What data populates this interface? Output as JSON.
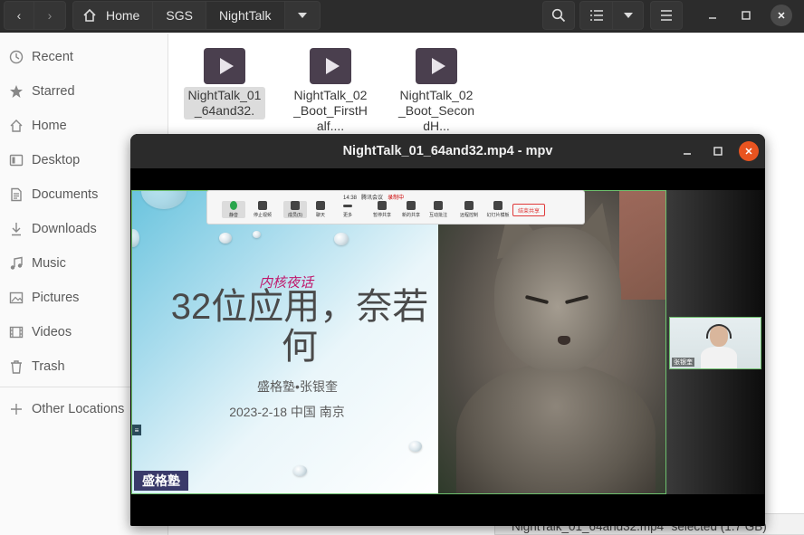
{
  "window": {
    "nav": {
      "back": "back-arrow",
      "forward": "forward-arrow"
    },
    "breadcrumbs": [
      "Home",
      "SGS",
      "NightTalk"
    ],
    "controls": {
      "search": "search-icon",
      "view": "list-view-icon",
      "menu": "hamburger-icon",
      "minimize": "minimize-icon",
      "maximize": "maximize-icon",
      "close": "close-icon"
    }
  },
  "sidebar": {
    "items": [
      {
        "label": "Recent",
        "icon": "clock-icon"
      },
      {
        "label": "Starred",
        "icon": "star-icon"
      },
      {
        "label": "Home",
        "icon": "home-icon"
      },
      {
        "label": "Desktop",
        "icon": "desktop-icon"
      },
      {
        "label": "Documents",
        "icon": "document-icon"
      },
      {
        "label": "Downloads",
        "icon": "download-icon"
      },
      {
        "label": "Music",
        "icon": "music-icon"
      },
      {
        "label": "Pictures",
        "icon": "picture-icon"
      },
      {
        "label": "Videos",
        "icon": "video-icon"
      },
      {
        "label": "Trash",
        "icon": "trash-icon"
      }
    ],
    "other": {
      "label": "Other Locations",
      "icon": "plus-icon"
    }
  },
  "files": [
    {
      "name": "NightTalk_01_64and32.",
      "selected": true
    },
    {
      "name": "NightTalk_02_Boot_FirstHalf....",
      "selected": false
    },
    {
      "name": "NightTalk_02_Boot_SecondH...",
      "selected": false
    }
  ],
  "statusbar": {
    "text": "NightTalk_01_64and32.mp4\" selected (1.7 GB)"
  },
  "mpv": {
    "title": "NightTalk_01_64and32.mp4 - mpv",
    "meeting": {
      "time": "14:38",
      "app": "腾讯会议",
      "rec": "录制中",
      "buttons": [
        "静音",
        "停止视频",
        "成员(5)",
        "聊天",
        "更多",
        "暂停共享",
        "新的共享",
        "互动批注",
        "远程控制",
        "幻灯片模板"
      ],
      "end": "结束共享"
    },
    "slide": {
      "topic": "内核夜话",
      "title": "32位应用，奈若何",
      "author": "盛格塾•张银奎",
      "date": "2023-2-18 中国 南京",
      "logo": "盛格塾"
    },
    "camera": {
      "tag": "张银奎"
    }
  }
}
